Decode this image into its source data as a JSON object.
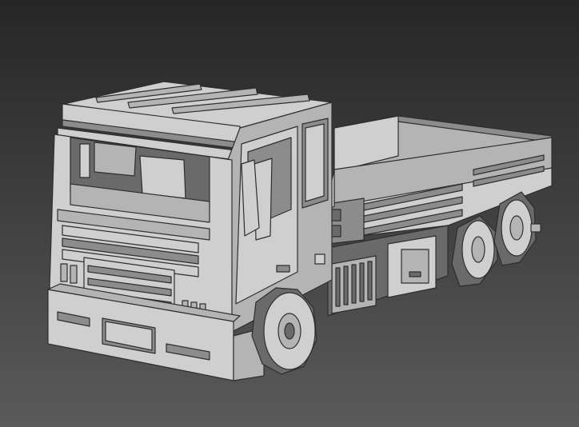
{
  "viewport": {
    "background_top": "#262626",
    "background_bottom": "#5a5a5a"
  },
  "model": {
    "subject": "voxel-truck-icon",
    "shade_light": "#cfcfcf",
    "shade_mid": "#b4b4b4",
    "shade_dark": "#8c8c8c",
    "shade_deep": "#6a6a6a",
    "edge": "#2e2e2e"
  }
}
